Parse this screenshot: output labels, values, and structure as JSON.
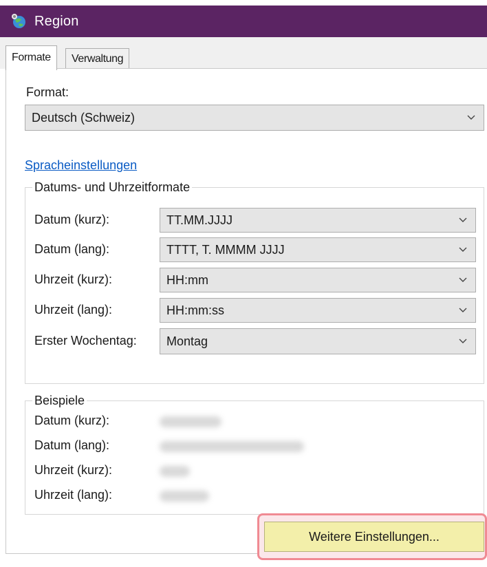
{
  "window": {
    "title": "Region",
    "icon": "globe-icon"
  },
  "tabs": [
    {
      "label": "Formate",
      "active": true
    },
    {
      "label": "Verwaltung",
      "active": false
    }
  ],
  "format": {
    "label": "Format:",
    "value": "Deutsch (Schweiz)"
  },
  "language_link": "Spracheinstellungen",
  "date_time_group": {
    "title": "Datums- und Uhrzeitformate",
    "rows": [
      {
        "label": "Datum (kurz):",
        "value": "TT.MM.JJJJ"
      },
      {
        "label": "Datum (lang):",
        "value": "TTTT, T. MMMM JJJJ"
      },
      {
        "label": "Uhrzeit (kurz):",
        "value": "HH:mm"
      },
      {
        "label": "Uhrzeit (lang):",
        "value": "HH:mm:ss"
      },
      {
        "label": "Erster Wochentag:",
        "value": "Montag"
      }
    ]
  },
  "examples_group": {
    "title": "Beispiele",
    "rows": [
      {
        "label": "Datum (kurz):"
      },
      {
        "label": "Datum (lang):"
      },
      {
        "label": "Uhrzeit (kurz):"
      },
      {
        "label": "Uhrzeit (lang):"
      }
    ]
  },
  "more_settings_button": "Weitere Einstellungen...",
  "colors": {
    "titlebar": "#5b2463",
    "link": "#0a5bc4",
    "button_highlight": "#f3efaa",
    "highlight_border": "#f08a93"
  }
}
